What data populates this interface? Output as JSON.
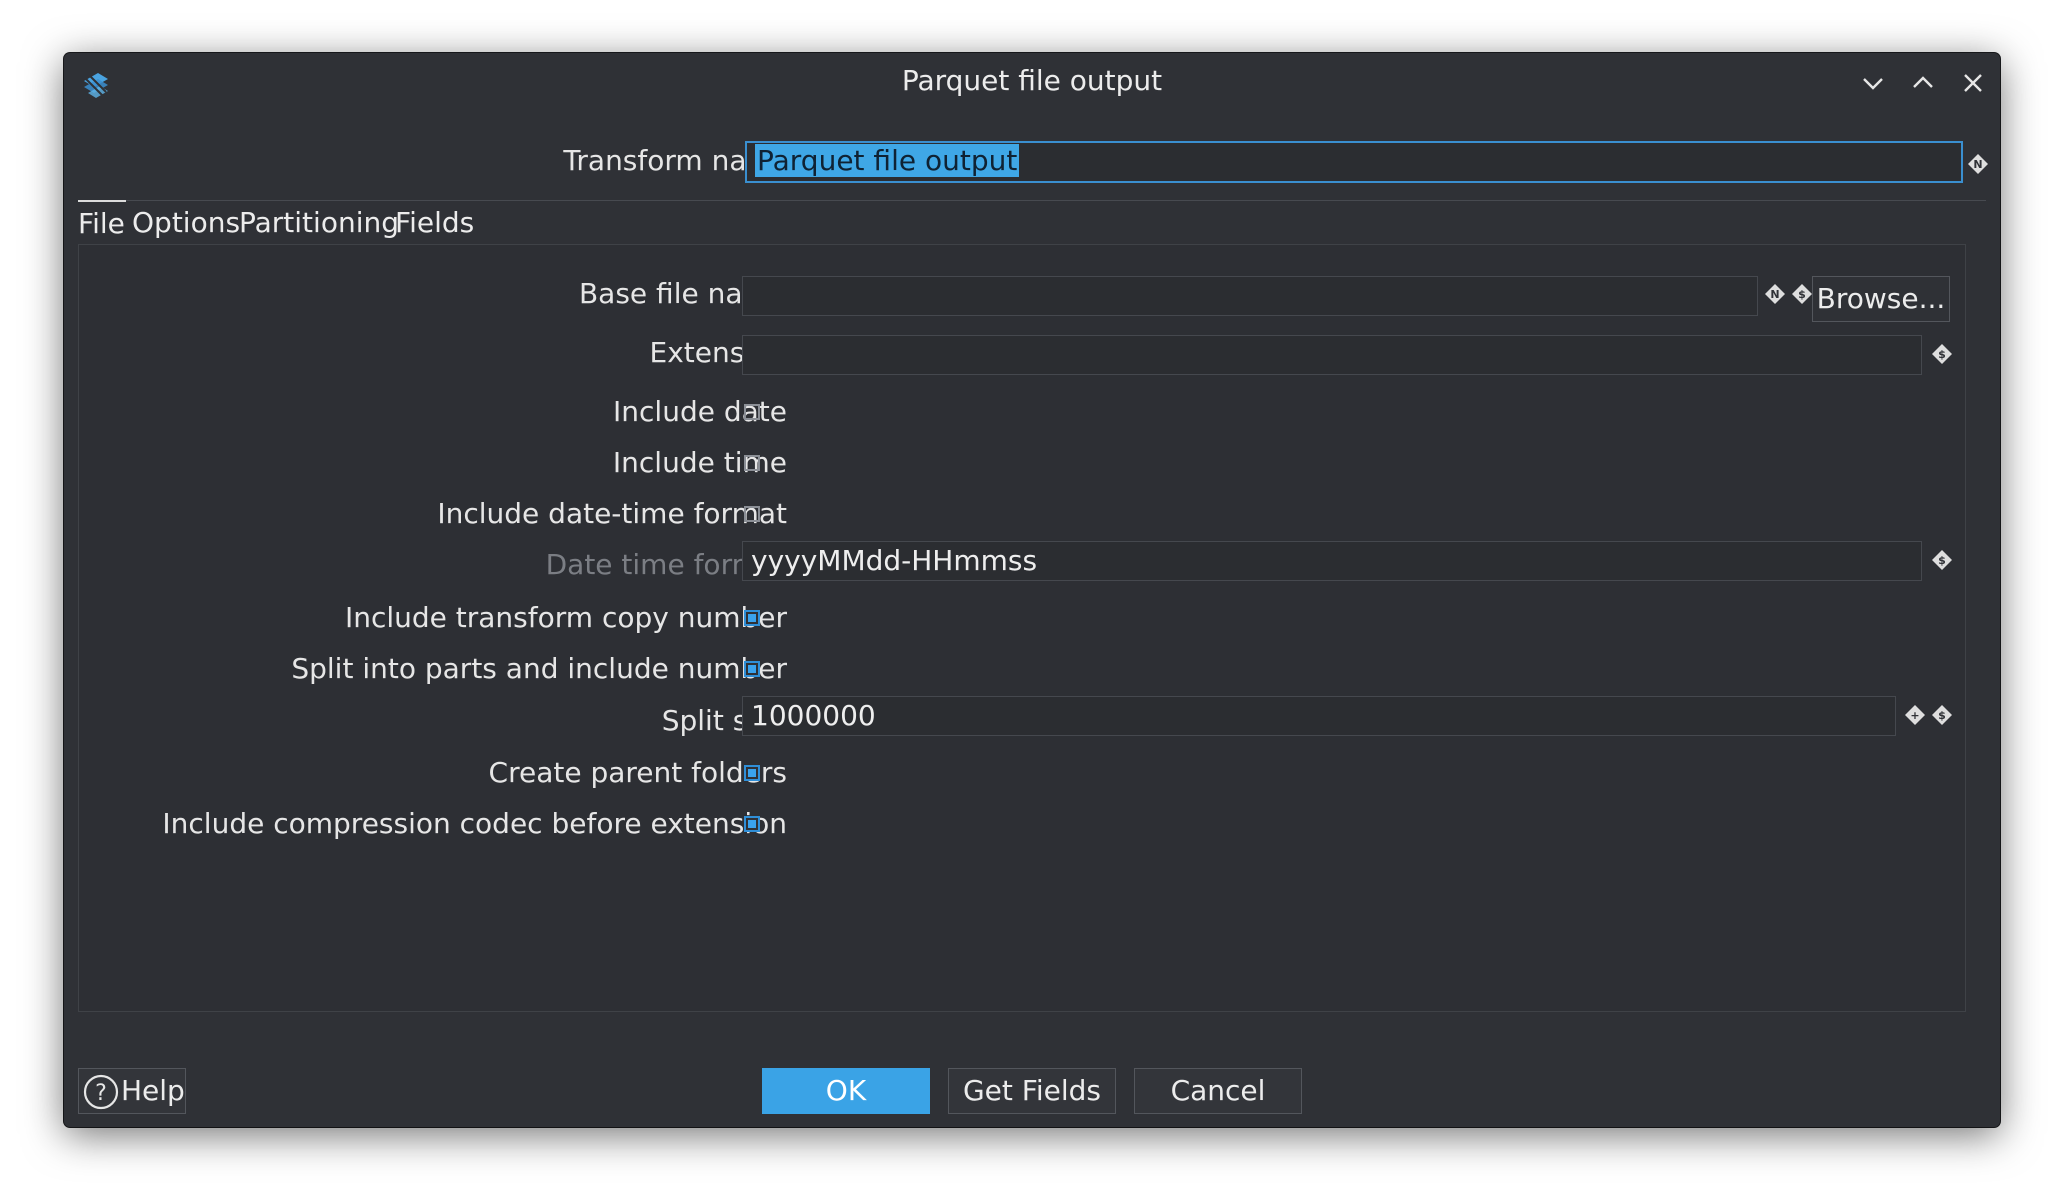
{
  "window": {
    "title": "Parquet file output",
    "app_icon": "hop-logo-icon",
    "controls": [
      "minimize-icon",
      "maximize-icon",
      "close-icon"
    ]
  },
  "transform_name": {
    "label": "Transform name",
    "value": "Parquet file output"
  },
  "tabs": [
    "File",
    "Options",
    "Partitioning",
    "Fields"
  ],
  "active_tab": "File",
  "file": {
    "base_file_name": {
      "label": "Base file name",
      "value": ""
    },
    "browse_label": "Browse...",
    "extension": {
      "label": "Extension",
      "value": ""
    },
    "include_date": {
      "label": "Include date",
      "checked": false
    },
    "include_time": {
      "label": "Include time",
      "checked": false
    },
    "include_datetime_format": {
      "label": "Include date-time format",
      "checked": false
    },
    "date_time_format": {
      "label": "Date time format",
      "value": "yyyyMMdd-HHmmss",
      "enabled": false
    },
    "include_copy_number": {
      "label": "Include transform copy number",
      "checked": true
    },
    "split_parts": {
      "label": "Split into parts and include number",
      "checked": true
    },
    "split_size": {
      "label": "Split size",
      "value": "1000000"
    },
    "create_parent_folders": {
      "label": "Create parent folders",
      "checked": true
    },
    "include_codec": {
      "label": "Include compression codec before extension",
      "checked": true
    }
  },
  "buttons": {
    "help": "Help",
    "ok": "OK",
    "get_fields": "Get Fields",
    "cancel": "Cancel"
  },
  "colors": {
    "background": "#2f3136",
    "accent": "#3aa3e6",
    "text": "#e6e6e6",
    "disabled_text": "#7b7e84"
  }
}
